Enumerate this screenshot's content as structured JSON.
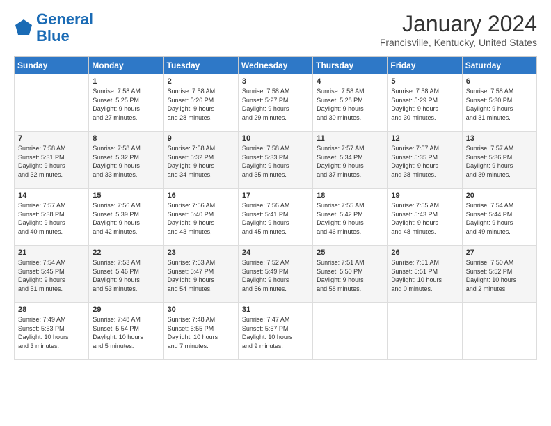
{
  "logo": {
    "line1": "General",
    "line2": "Blue"
  },
  "title": "January 2024",
  "location": "Francisville, Kentucky, United States",
  "days_header": [
    "Sunday",
    "Monday",
    "Tuesday",
    "Wednesday",
    "Thursday",
    "Friday",
    "Saturday"
  ],
  "weeks": [
    [
      {
        "day": "",
        "info": ""
      },
      {
        "day": "1",
        "info": "Sunrise: 7:58 AM\nSunset: 5:25 PM\nDaylight: 9 hours\nand 27 minutes."
      },
      {
        "day": "2",
        "info": "Sunrise: 7:58 AM\nSunset: 5:26 PM\nDaylight: 9 hours\nand 28 minutes."
      },
      {
        "day": "3",
        "info": "Sunrise: 7:58 AM\nSunset: 5:27 PM\nDaylight: 9 hours\nand 29 minutes."
      },
      {
        "day": "4",
        "info": "Sunrise: 7:58 AM\nSunset: 5:28 PM\nDaylight: 9 hours\nand 30 minutes."
      },
      {
        "day": "5",
        "info": "Sunrise: 7:58 AM\nSunset: 5:29 PM\nDaylight: 9 hours\nand 30 minutes."
      },
      {
        "day": "6",
        "info": "Sunrise: 7:58 AM\nSunset: 5:30 PM\nDaylight: 9 hours\nand 31 minutes."
      }
    ],
    [
      {
        "day": "7",
        "info": "Sunrise: 7:58 AM\nSunset: 5:31 PM\nDaylight: 9 hours\nand 32 minutes."
      },
      {
        "day": "8",
        "info": "Sunrise: 7:58 AM\nSunset: 5:32 PM\nDaylight: 9 hours\nand 33 minutes."
      },
      {
        "day": "9",
        "info": "Sunrise: 7:58 AM\nSunset: 5:32 PM\nDaylight: 9 hours\nand 34 minutes."
      },
      {
        "day": "10",
        "info": "Sunrise: 7:58 AM\nSunset: 5:33 PM\nDaylight: 9 hours\nand 35 minutes."
      },
      {
        "day": "11",
        "info": "Sunrise: 7:57 AM\nSunset: 5:34 PM\nDaylight: 9 hours\nand 37 minutes."
      },
      {
        "day": "12",
        "info": "Sunrise: 7:57 AM\nSunset: 5:35 PM\nDaylight: 9 hours\nand 38 minutes."
      },
      {
        "day": "13",
        "info": "Sunrise: 7:57 AM\nSunset: 5:36 PM\nDaylight: 9 hours\nand 39 minutes."
      }
    ],
    [
      {
        "day": "14",
        "info": "Sunrise: 7:57 AM\nSunset: 5:38 PM\nDaylight: 9 hours\nand 40 minutes."
      },
      {
        "day": "15",
        "info": "Sunrise: 7:56 AM\nSunset: 5:39 PM\nDaylight: 9 hours\nand 42 minutes."
      },
      {
        "day": "16",
        "info": "Sunrise: 7:56 AM\nSunset: 5:40 PM\nDaylight: 9 hours\nand 43 minutes."
      },
      {
        "day": "17",
        "info": "Sunrise: 7:56 AM\nSunset: 5:41 PM\nDaylight: 9 hours\nand 45 minutes."
      },
      {
        "day": "18",
        "info": "Sunrise: 7:55 AM\nSunset: 5:42 PM\nDaylight: 9 hours\nand 46 minutes."
      },
      {
        "day": "19",
        "info": "Sunrise: 7:55 AM\nSunset: 5:43 PM\nDaylight: 9 hours\nand 48 minutes."
      },
      {
        "day": "20",
        "info": "Sunrise: 7:54 AM\nSunset: 5:44 PM\nDaylight: 9 hours\nand 49 minutes."
      }
    ],
    [
      {
        "day": "21",
        "info": "Sunrise: 7:54 AM\nSunset: 5:45 PM\nDaylight: 9 hours\nand 51 minutes."
      },
      {
        "day": "22",
        "info": "Sunrise: 7:53 AM\nSunset: 5:46 PM\nDaylight: 9 hours\nand 53 minutes."
      },
      {
        "day": "23",
        "info": "Sunrise: 7:53 AM\nSunset: 5:47 PM\nDaylight: 9 hours\nand 54 minutes."
      },
      {
        "day": "24",
        "info": "Sunrise: 7:52 AM\nSunset: 5:49 PM\nDaylight: 9 hours\nand 56 minutes."
      },
      {
        "day": "25",
        "info": "Sunrise: 7:51 AM\nSunset: 5:50 PM\nDaylight: 9 hours\nand 58 minutes."
      },
      {
        "day": "26",
        "info": "Sunrise: 7:51 AM\nSunset: 5:51 PM\nDaylight: 10 hours\nand 0 minutes."
      },
      {
        "day": "27",
        "info": "Sunrise: 7:50 AM\nSunset: 5:52 PM\nDaylight: 10 hours\nand 2 minutes."
      }
    ],
    [
      {
        "day": "28",
        "info": "Sunrise: 7:49 AM\nSunset: 5:53 PM\nDaylight: 10 hours\nand 3 minutes."
      },
      {
        "day": "29",
        "info": "Sunrise: 7:48 AM\nSunset: 5:54 PM\nDaylight: 10 hours\nand 5 minutes."
      },
      {
        "day": "30",
        "info": "Sunrise: 7:48 AM\nSunset: 5:55 PM\nDaylight: 10 hours\nand 7 minutes."
      },
      {
        "day": "31",
        "info": "Sunrise: 7:47 AM\nSunset: 5:57 PM\nDaylight: 10 hours\nand 9 minutes."
      },
      {
        "day": "",
        "info": ""
      },
      {
        "day": "",
        "info": ""
      },
      {
        "day": "",
        "info": ""
      }
    ]
  ]
}
